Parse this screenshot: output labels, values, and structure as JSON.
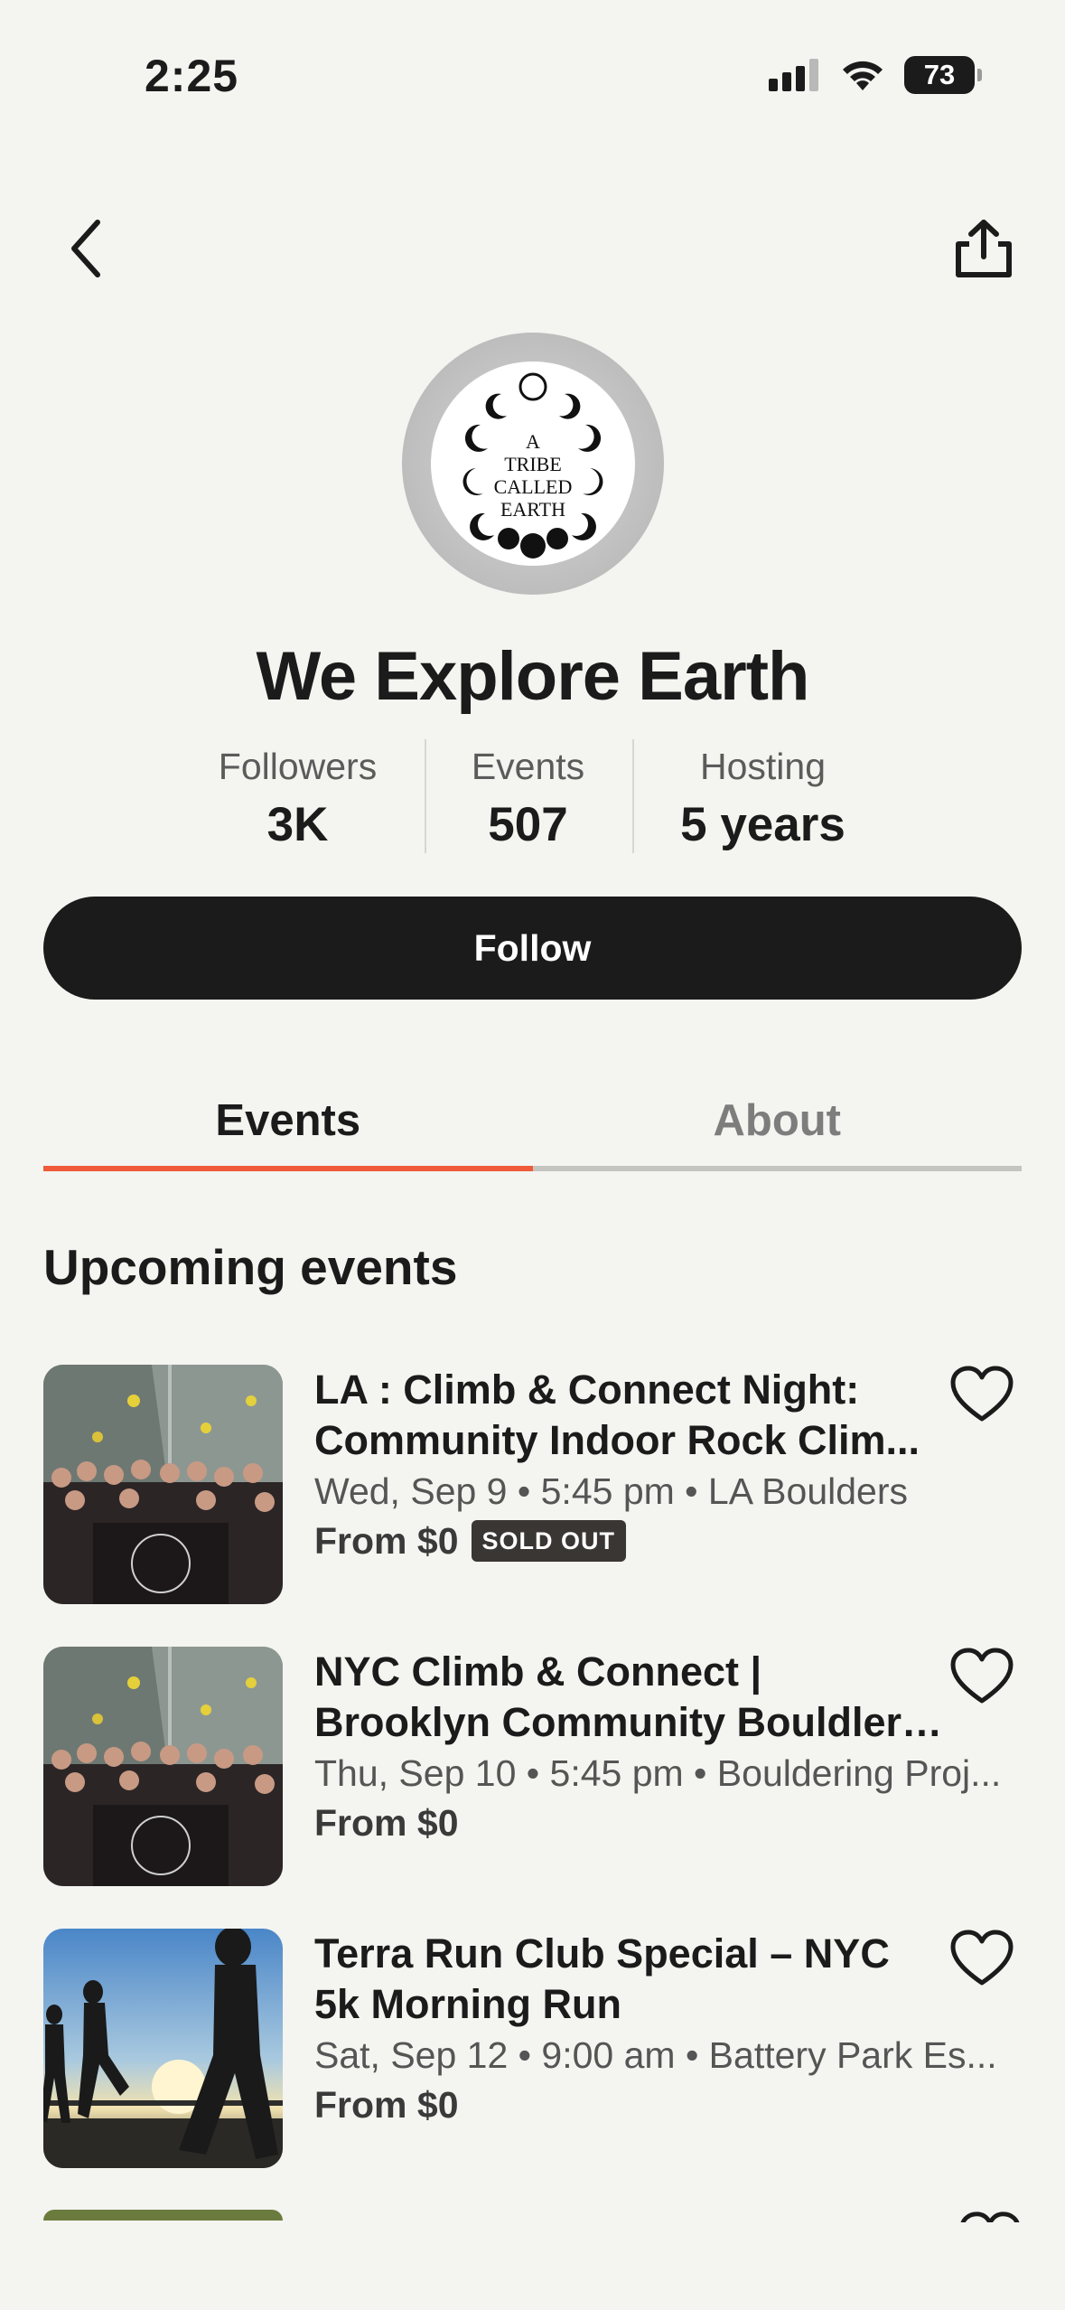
{
  "status_bar": {
    "time": "2:25",
    "battery": "73"
  },
  "organizer": {
    "name": "We Explore Earth",
    "logo_text": [
      "A",
      "TRIBE",
      "CALLED",
      "EARTH"
    ],
    "stats": [
      {
        "label": "Followers",
        "value": "3K"
      },
      {
        "label": "Events",
        "value": "507"
      },
      {
        "label": "Hosting",
        "value": "5 years"
      }
    ],
    "follow_label": "Follow"
  },
  "tabs": [
    {
      "label": "Events",
      "active": true
    },
    {
      "label": "About",
      "active": false
    }
  ],
  "section_title": "Upcoming events",
  "events": [
    {
      "title_line1": "LA : Climb & Connect Night:",
      "title_line2": "Community Indoor Rock Clim...",
      "meta": "Wed, Sep 9 • 5:45 pm • LA Boulders",
      "price": "From $0",
      "badge": "SOLD OUT",
      "image": "climbing-group-photo"
    },
    {
      "title_line1": "NYC Climb & Connect |",
      "title_line2": "Brooklyn Community Bouldleri...",
      "meta": "Thu, Sep 10 • 5:45 pm • Bouldering Proj...",
      "price": "From $0",
      "badge": "",
      "image": "climbing-group-photo"
    },
    {
      "title_line1": "Terra Run Club Special – NYC",
      "title_line2": "5k Morning Run",
      "meta": "Sat, Sep 12 • 9:00 am • Battery Park Es...",
      "price": "From $0",
      "badge": "",
      "image": "runners-sunrise-photo"
    }
  ],
  "colors": {
    "accent": "#ef5a3a",
    "dark": "#1b1b1b",
    "background": "#f4f4f0"
  }
}
